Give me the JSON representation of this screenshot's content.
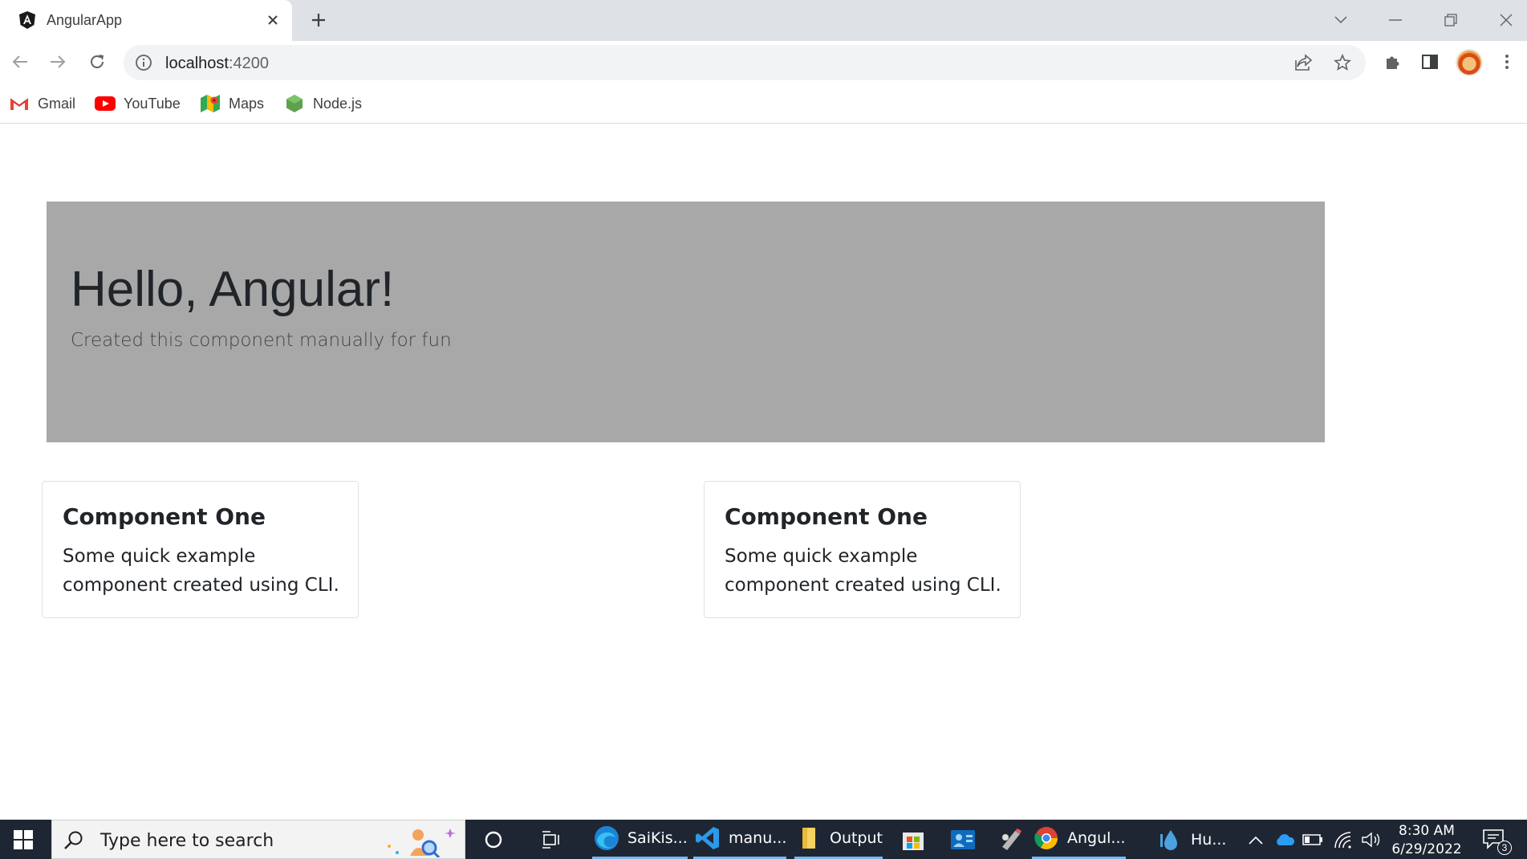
{
  "browser": {
    "tab": {
      "title": "AngularApp",
      "favicon": "angular-icon"
    },
    "address": {
      "host": "localhost",
      "port": ":4200"
    },
    "bookmarks": [
      {
        "label": "Gmail",
        "icon": "gmail-icon"
      },
      {
        "label": "YouTube",
        "icon": "youtube-icon"
      },
      {
        "label": "Maps",
        "icon": "maps-icon"
      },
      {
        "label": "Node.js",
        "icon": "nodejs-icon"
      }
    ]
  },
  "page": {
    "jumbotron": {
      "title": "Hello, Angular!",
      "lead": "Created this component manually for fun"
    },
    "cards": [
      {
        "title": "Component One",
        "text": "Some quick example component created using CLI."
      },
      {
        "title": "Component One",
        "text": "Some quick example component created using CLI."
      }
    ]
  },
  "taskbar": {
    "search_placeholder": "Type here to search",
    "apps": [
      {
        "label": "SaiKis...",
        "icon": "edge-icon"
      },
      {
        "label": "manu...",
        "icon": "vscode-icon"
      },
      {
        "label": "Output",
        "icon": "folder-icon"
      },
      {
        "label": "",
        "icon": "store-icon"
      },
      {
        "label": "",
        "icon": "people-icon"
      },
      {
        "label": "",
        "icon": "paint-icon"
      },
      {
        "label": "Angul...",
        "icon": "chrome-icon"
      },
      {
        "label": "Hu...",
        "icon": "drop-icon"
      }
    ],
    "clock": {
      "time": "8:30 AM",
      "date": "6/29/2022"
    },
    "notification_count": "3"
  },
  "colors": {
    "jumbotron_bg": "#a8a8a8",
    "taskbar_bg": "#1f2633",
    "tabstrip_bg": "#dee1e6"
  }
}
